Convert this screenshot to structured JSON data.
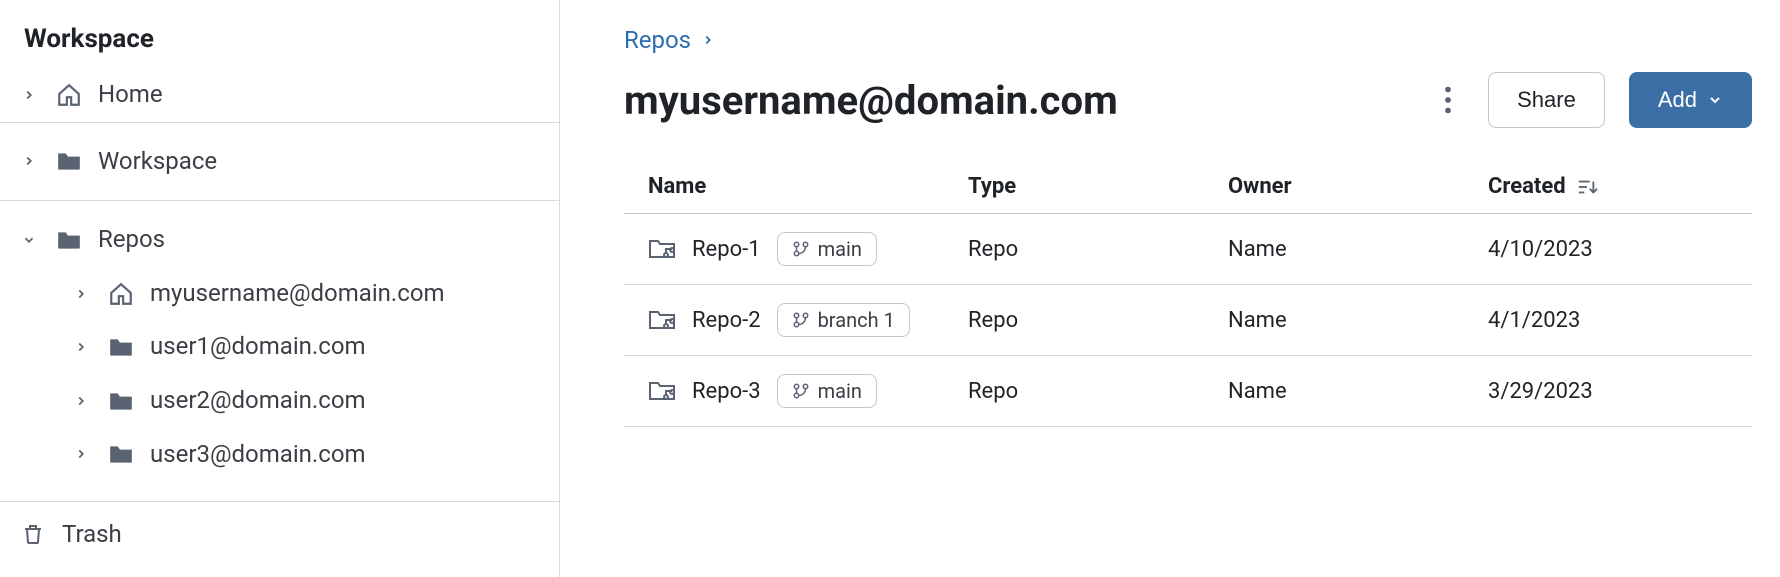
{
  "sidebar": {
    "title": "Workspace",
    "home": {
      "label": "Home"
    },
    "workspace": {
      "label": "Workspace"
    },
    "repos": {
      "label": "Repos",
      "children": [
        {
          "label": "myusername@domain.com",
          "icon": "home"
        },
        {
          "label": "user1@domain.com",
          "icon": "folder"
        },
        {
          "label": "user2@domain.com",
          "icon": "folder"
        },
        {
          "label": "user3@domain.com",
          "icon": "folder"
        }
      ]
    },
    "trash": {
      "label": "Trash"
    }
  },
  "breadcrumb": {
    "repos": "Repos"
  },
  "header": {
    "title": "myusername@domain.com",
    "share_label": "Share",
    "add_label": "Add"
  },
  "table": {
    "columns": {
      "name": "Name",
      "type": "Type",
      "owner": "Owner",
      "created": "Created"
    },
    "rows": [
      {
        "name": "Repo-1",
        "branch": "main",
        "type": "Repo",
        "owner": "Name",
        "created": "4/10/2023"
      },
      {
        "name": "Repo-2",
        "branch": "branch 1",
        "type": "Repo",
        "owner": "Name",
        "created": "4/1/2023"
      },
      {
        "name": "Repo-3",
        "branch": "main",
        "type": "Repo",
        "owner": "Name",
        "created": "3/29/2023"
      }
    ]
  }
}
